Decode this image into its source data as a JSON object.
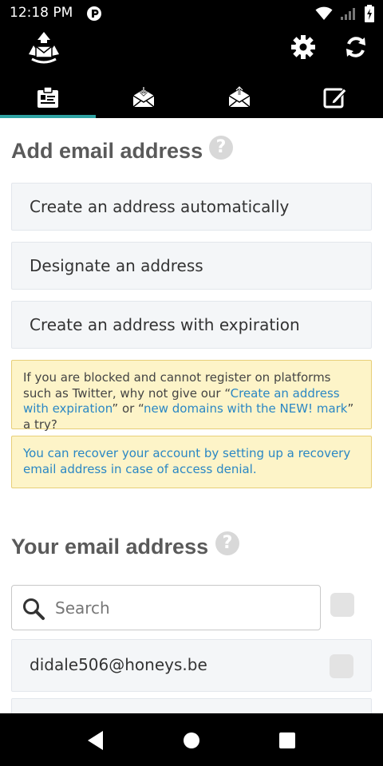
{
  "status_bar": {
    "time": "12:18 PM",
    "icons": [
      "app-notification-icon",
      "wifi-icon",
      "signal-icon",
      "battery-icon"
    ]
  },
  "app_bar": {
    "logo_icon": "recycle-mail-logo-icon",
    "actions": [
      "gear-icon",
      "refresh-icon"
    ]
  },
  "tabs": [
    {
      "icon": "clipboard-icon",
      "active": true
    },
    {
      "icon": "inbox-download-icon",
      "active": false
    },
    {
      "icon": "outbox-upload-icon",
      "active": false
    },
    {
      "icon": "compose-icon",
      "active": false
    }
  ],
  "add_section": {
    "title": "Add email address",
    "options": [
      "Create an address automatically",
      "Designate an address",
      "Create an address with expiration"
    ],
    "notice1": {
      "text_before": "If you are blocked and cannot register on platforms such as Twitter, why not give our “",
      "link1": "Create an address with expiration",
      "text_middle": "” or “",
      "link2": "new domains with the NEW! mark",
      "text_after": "” a try?"
    },
    "notice2": {
      "link": "You can recover your account by setting up a recovery email address in case of access denial."
    }
  },
  "your_section": {
    "title": "Your email address",
    "search_placeholder": "Search",
    "addresses": [
      "didale506@honeys.be"
    ]
  },
  "colors": {
    "accent": "#2fa3a3",
    "link": "#2a87c4",
    "notice_bg": "#fdf4c8",
    "notice_border": "#e7cf78"
  }
}
